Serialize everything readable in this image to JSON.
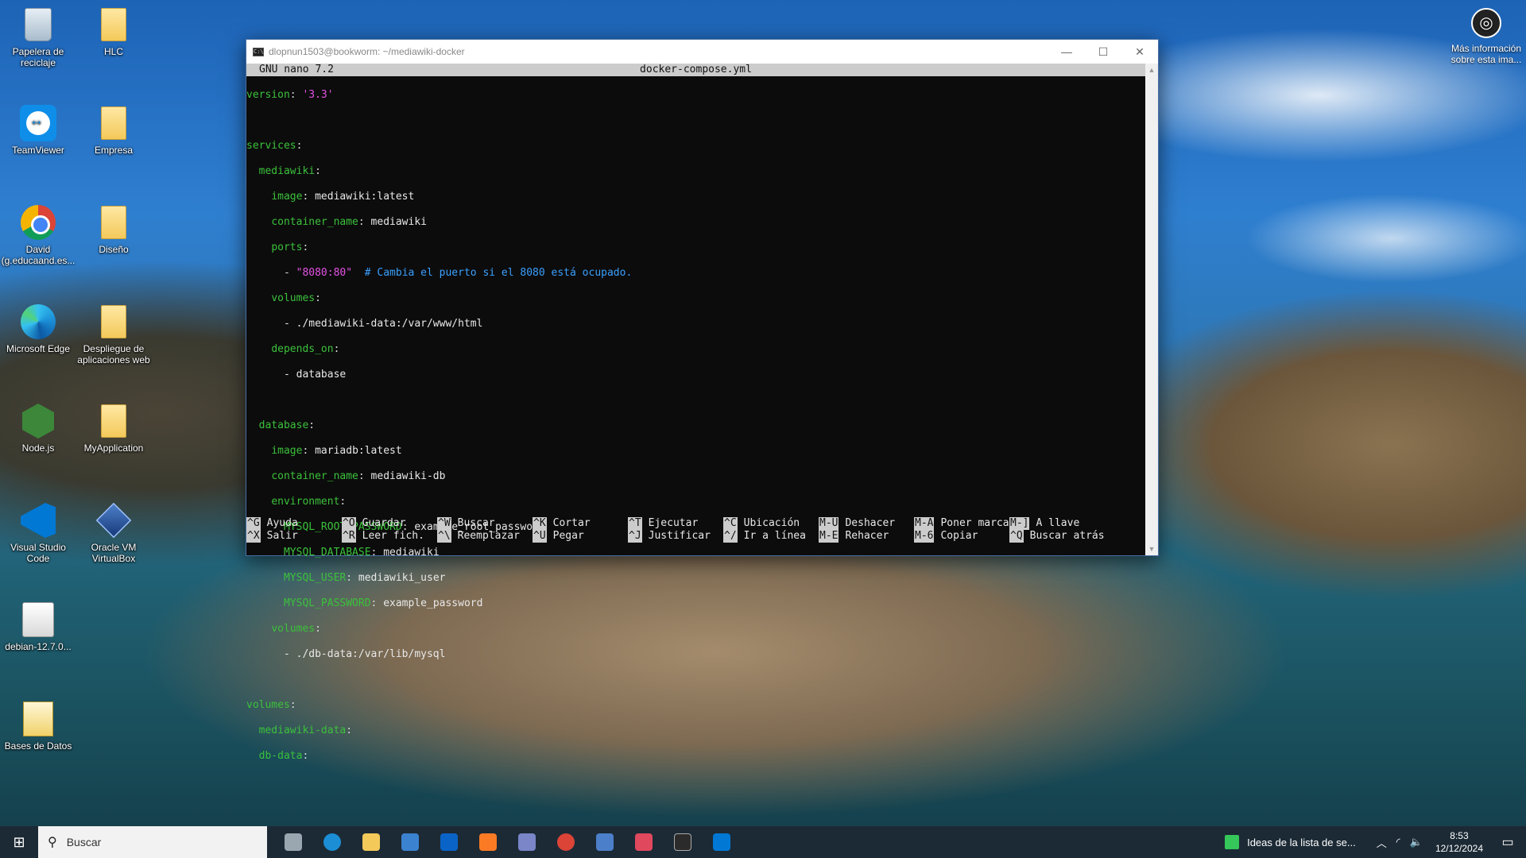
{
  "desktop_icons": [
    {
      "label": "Papelera de reciclaje",
      "icon": "recycle-bin-icon"
    },
    {
      "label": "HLC",
      "icon": "folder-icon"
    },
    {
      "label": "TeamViewer",
      "icon": "teamviewer-icon"
    },
    {
      "label": "Empresa",
      "icon": "folder-icon"
    },
    {
      "label": "David (g.educaand.es...",
      "icon": "chrome-icon"
    },
    {
      "label": "Diseño",
      "icon": "folder-icon"
    },
    {
      "label": "Microsoft Edge",
      "icon": "edge-icon"
    },
    {
      "label": "Despliegue de aplicaciones web",
      "icon": "folder-icon"
    },
    {
      "label": "Node.js",
      "icon": "nodejs-icon"
    },
    {
      "label": "MyApplication",
      "icon": "folder-icon"
    },
    {
      "label": "Visual Studio Code",
      "icon": "vscode-icon"
    },
    {
      "label": "Oracle VM VirtualBox",
      "icon": "virtualbox-icon"
    },
    {
      "label": "debian-12.7.0...",
      "icon": "disc-image-icon"
    },
    {
      "label": "Bases de Datos",
      "icon": "database-file-icon"
    }
  ],
  "info_widget": {
    "label": "Más información sobre esta ima..."
  },
  "window": {
    "title": "dlopnun1503@bookworm: ~/mediawiki-docker",
    "minimize": "—",
    "maximize": "☐",
    "close": "✕"
  },
  "nano": {
    "version": "GNU nano 7.2",
    "filename": "docker-compose.yml",
    "code": {
      "version_key": "version",
      "version_val": "'3.3'",
      "services_key": "services",
      "mediawiki_key": "mediawiki",
      "image_key": "image",
      "image_val": " mediawiki:latest",
      "container_name_key": "container_name",
      "container_name_val": " mediawiki",
      "ports_key": "ports",
      "port_val": "\"8080:80\"",
      "port_comment": "  # Cambia el puerto si el 8080 está ocupado.",
      "volumes_key": "volumes",
      "volume_val": "- ./mediawiki-data:/var/www/html",
      "depends_on_key": "depends_on",
      "depends_val": "- database",
      "database_key": "database",
      "db_image_key": "image",
      "db_image_val": " mariadb:latest",
      "db_container_key": "container_name",
      "db_container_val": " mediawiki-db",
      "environment_key": "environment",
      "env_root_key": "MYSQL_ROOT_PASSWORD",
      "env_root_val": " example_root_password",
      "env_db_key": "MYSQL_DATABASE",
      "env_db_val": " mediawiki",
      "env_user_key": "MYSQL_USER",
      "env_user_val": " mediawiki_user",
      "env_pass_key": "MYSQL_PASSWORD",
      "env_pass_val": " example_password",
      "db_volumes_key": "volumes",
      "db_volume_val": "- ./db-data:/var/lib/mysql",
      "top_volumes_key": "volumes",
      "mw_data_key": "mediawiki-data",
      "db_data_key": "db-data"
    },
    "shortcuts_row1": [
      {
        "key": "^G",
        "label": "Ayuda"
      },
      {
        "key": "^O",
        "label": "Guardar"
      },
      {
        "key": "^W",
        "label": "Buscar"
      },
      {
        "key": "^K",
        "label": "Cortar"
      },
      {
        "key": "^T",
        "label": "Ejecutar"
      },
      {
        "key": "^C",
        "label": "Ubicación"
      },
      {
        "key": "M-U",
        "label": "Deshacer"
      },
      {
        "key": "M-A",
        "label": "Poner marca"
      },
      {
        "key": "M-]",
        "label": "A llave"
      }
    ],
    "shortcuts_row2": [
      {
        "key": "^X",
        "label": "Salir"
      },
      {
        "key": "^R",
        "label": "Leer fich."
      },
      {
        "key": "^\\",
        "label": "Reemplazar"
      },
      {
        "key": "^U",
        "label": "Pegar"
      },
      {
        "key": "^J",
        "label": "Justificar"
      },
      {
        "key": "^/",
        "label": "Ir a línea"
      },
      {
        "key": "M-E",
        "label": "Rehacer"
      },
      {
        "key": "M-6",
        "label": "Copiar"
      },
      {
        "key": "^Q",
        "label": "Buscar atrás"
      }
    ]
  },
  "taskbar": {
    "search_placeholder": "Buscar",
    "news": "Ideas de la lista de se...",
    "time": "8:53",
    "date": "12/12/2024",
    "pinned": [
      "task-view-icon",
      "edge-icon",
      "file-explorer-icon",
      "store-icon",
      "outlook-icon",
      "xampp-icon",
      "snipping-tool-icon",
      "chrome-icon",
      "virtualbox-icon",
      "screen-recorder-icon",
      "terminal-icon",
      "vscode-icon"
    ]
  }
}
